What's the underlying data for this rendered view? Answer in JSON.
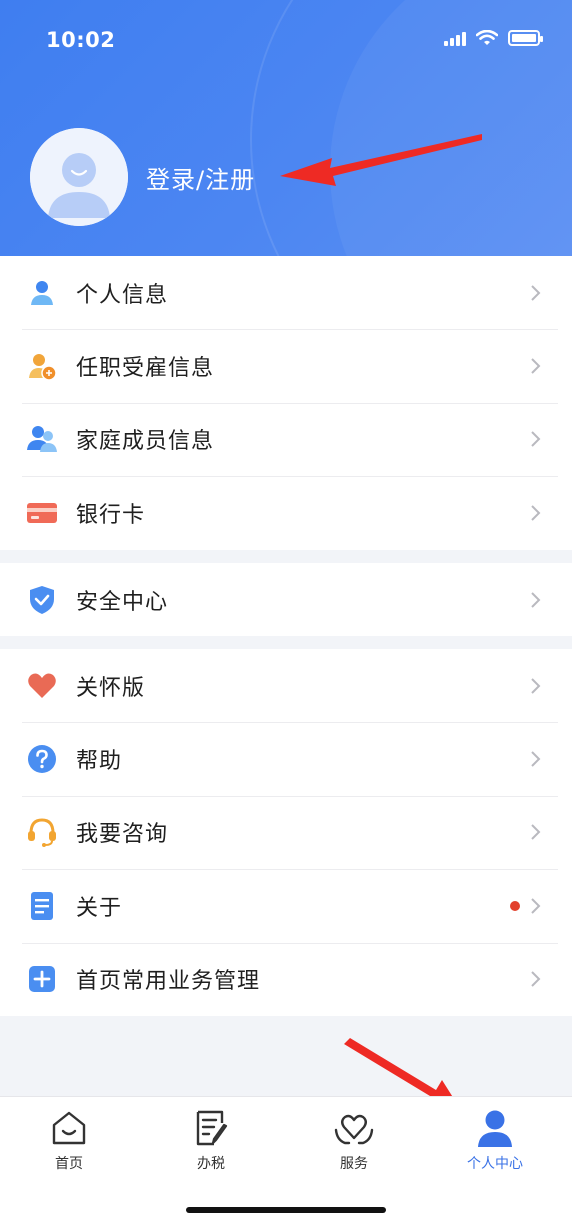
{
  "status": {
    "time": "10:02"
  },
  "profile": {
    "login_label": "登录/注册"
  },
  "menu": {
    "group1": [
      {
        "label": "个人信息",
        "icon": "person-icon"
      },
      {
        "label": "任职受雇信息",
        "icon": "employment-icon"
      },
      {
        "label": "家庭成员信息",
        "icon": "family-icon"
      },
      {
        "label": "银行卡",
        "icon": "bank-card-icon"
      }
    ],
    "group2": [
      {
        "label": "安全中心",
        "icon": "shield-icon"
      }
    ],
    "group3": [
      {
        "label": "关怀版",
        "icon": "heart-icon"
      },
      {
        "label": "帮助",
        "icon": "help-icon"
      },
      {
        "label": "我要咨询",
        "icon": "headset-icon"
      },
      {
        "label": "关于",
        "icon": "document-icon",
        "badge": "red-dot"
      },
      {
        "label": "首页常用业务管理",
        "icon": "plus-icon"
      }
    ]
  },
  "tabbar": {
    "items": [
      {
        "label": "首页",
        "icon": "home-icon",
        "active": false
      },
      {
        "label": "办税",
        "icon": "tax-form-icon",
        "active": false
      },
      {
        "label": "服务",
        "icon": "service-heart-icon",
        "active": false
      },
      {
        "label": "个人中心",
        "icon": "profile-icon",
        "active": true
      }
    ]
  },
  "colors": {
    "header_blue": "#4682f1",
    "accent_blue": "#3a72e6",
    "annotation_red": "#ee2a24",
    "badge_red": "#e2402c"
  }
}
